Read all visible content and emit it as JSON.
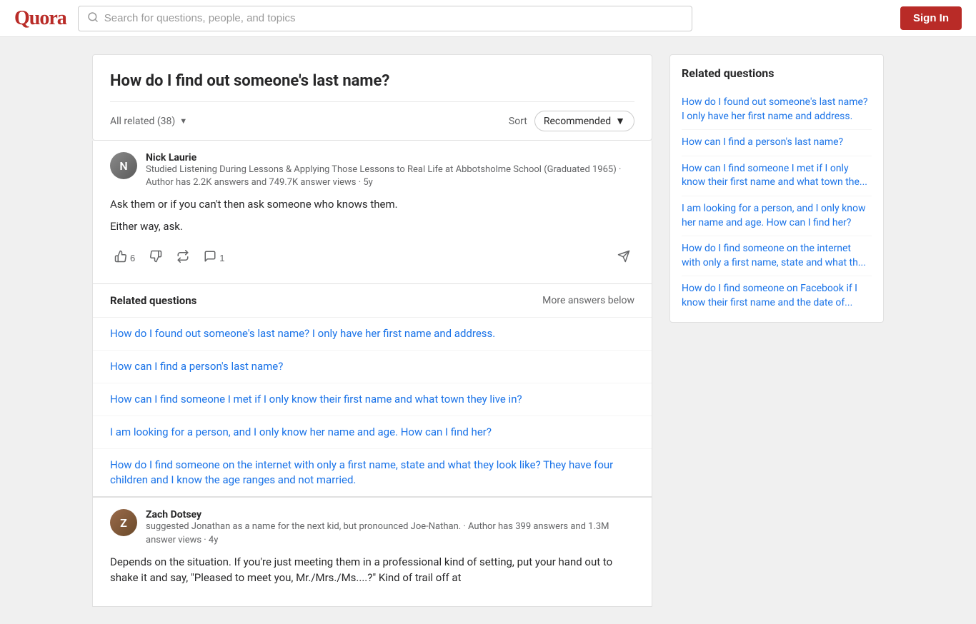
{
  "header": {
    "logo": "Quora",
    "search_placeholder": "Search for questions, people, and topics",
    "sign_in_label": "Sign In"
  },
  "main": {
    "question_title": "How do I find out someone's last name?",
    "filter": {
      "all_related": "All related (38)",
      "sort_label": "Sort",
      "recommended": "Recommended"
    },
    "answers": [
      {
        "id": "nick",
        "author_name": "Nick Laurie",
        "author_bio": "Studied Listening During Lessons & Applying Those Lessons to Real Life at Abbotsholme School (Graduated 1965) · Author has 2.2K answers and 749.7K answer views · 5y",
        "author_initials": "N",
        "answer_lines": [
          "Ask them or if you can't then ask someone who knows them.",
          "Either way, ask."
        ],
        "upvotes": "6",
        "comments": "1"
      },
      {
        "id": "zach",
        "author_name": "Zach Dotsey",
        "author_bio": "suggested Jonathan as a name for the next kid, but pronounced Joe-Nathan. · Author has 399 answers and 1.3M answer views · 4y",
        "author_initials": "Z",
        "answer_lines": [
          "Depends on the situation. If you're just meeting them in a professional kind of setting, put your hand out to shake it and say, \"Pleased to meet you, Mr./Mrs./Ms....?\" Kind of trail off at"
        ],
        "upvotes": "",
        "comments": ""
      }
    ],
    "related_questions": {
      "title": "Related questions",
      "more_label": "More answers below",
      "links": [
        "How do I found out someone's last name? I only have her first name and address.",
        "How can I find a person's last name?",
        "How can I find someone I met if I only know their first name and what town they live in?",
        "I am looking for a person, and I only know her name and age. How can I find her?",
        "How do I find someone on the internet with only a first name, state and what they look like? They have four children and I know the age ranges and not married."
      ]
    }
  },
  "sidebar": {
    "title": "Related questions",
    "links": [
      "How do I found out someone's last name? I only have her first name and address.",
      "How can I find a person's last name?",
      "How can I find someone I met if I only know their first name and what town the...",
      "I am looking for a person, and I only know her name and age. How can I find her?",
      "How do I find someone on the internet with only a first name, state and what th...",
      "How do I find someone on Facebook if I know their first name and the date of..."
    ]
  }
}
